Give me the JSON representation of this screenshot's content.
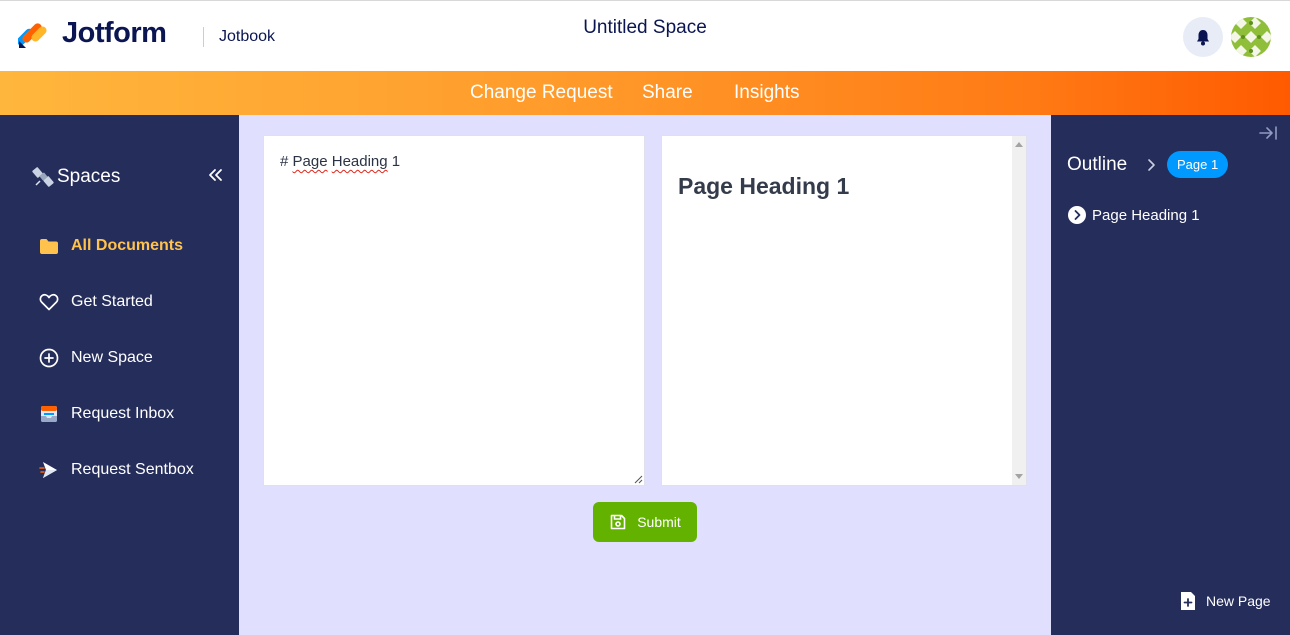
{
  "header": {
    "brand": "Jotform",
    "product": "Jotbook",
    "space_title": "Untitled Space"
  },
  "nav": {
    "items": [
      "Change Request",
      "Share",
      "Insights"
    ]
  },
  "sidebar": {
    "title": "Spaces",
    "items": [
      {
        "label": "All Documents",
        "icon": "folder-icon",
        "active": true
      },
      {
        "label": "Get Started",
        "icon": "heart-icon"
      },
      {
        "label": "New Space",
        "icon": "plus-circle-icon"
      },
      {
        "label": "Request Inbox",
        "icon": "inbox-icon"
      },
      {
        "label": "Request Sentbox",
        "icon": "send-icon"
      }
    ]
  },
  "editor": {
    "hash": "#",
    "word_page": "Page",
    "word_heading": "Heading",
    "suffix": "1"
  },
  "preview": {
    "heading": "Page Heading 1"
  },
  "submit": {
    "label": "Submit"
  },
  "outline": {
    "title": "Outline",
    "page_pill": "Page 1",
    "items": [
      "Page Heading 1"
    ],
    "new_page_label": "New Page"
  },
  "colors": {
    "sidebar_bg": "#252d5b",
    "main_bg": "#e0e0fe",
    "accent_orange": "#ff7a14",
    "active_item": "#ffc24d",
    "submit_green": "#64b200",
    "pill_blue": "#0099ff"
  }
}
